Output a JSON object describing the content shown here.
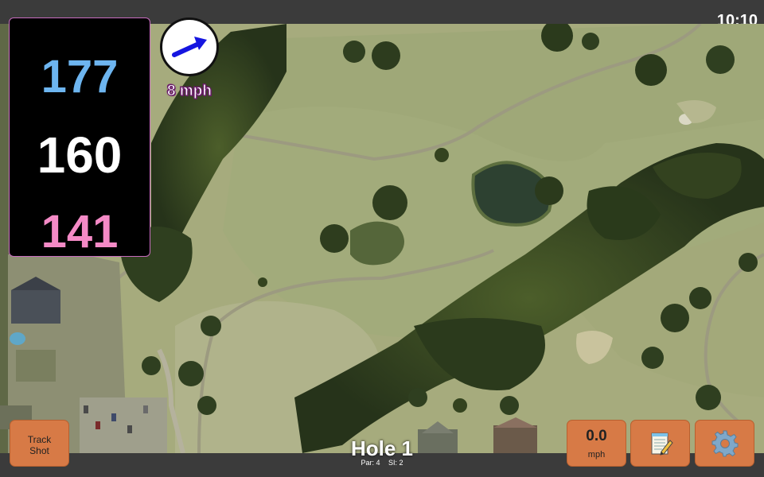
{
  "status_bar": {
    "clock": "10:10"
  },
  "distances": {
    "back": "177",
    "middle": "160",
    "front": "141"
  },
  "wind": {
    "speed": "8 mph",
    "direction_icon": "arrow-icon"
  },
  "hole": {
    "title": "Hole 1",
    "par_label": "Par: 4",
    "si_label": "SI: 2"
  },
  "buttons": {
    "track_shot_line1": "Track",
    "track_shot_line2": "Shot",
    "speed_value": "0.0",
    "speed_unit": "mph",
    "notes_icon": "notepad-icon",
    "settings_icon": "gear-icon"
  },
  "colors": {
    "back_distance": "#6db5f0",
    "middle_distance": "#ffffff",
    "front_distance": "#f48ac6",
    "button_accent": "#d77a46"
  }
}
